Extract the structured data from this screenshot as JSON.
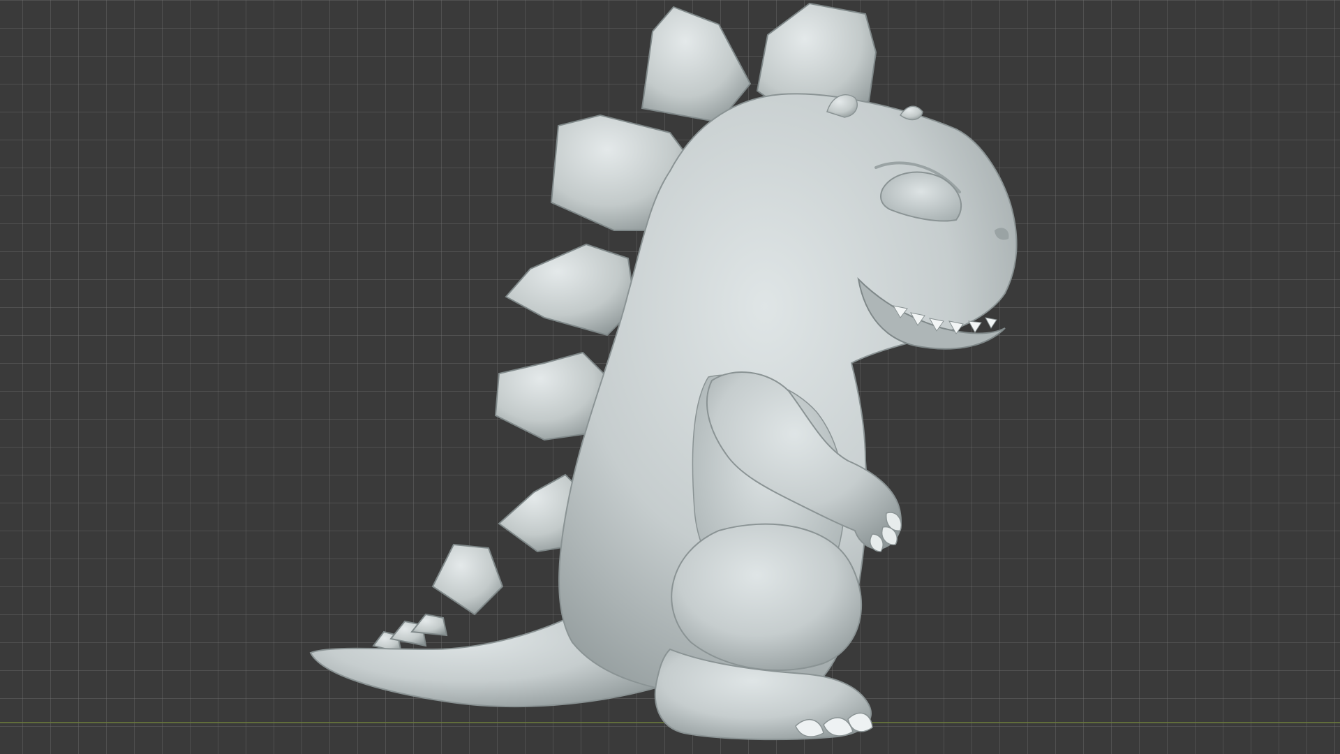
{
  "viewport": {
    "label": "",
    "background_color": "#3a3a3a",
    "grid_color": "#5a5a5a",
    "ground_axis_color": "#6b7a3c",
    "model": {
      "name": "",
      "surface_color": "#c9d0d1",
      "shadow_color": "#8e9798"
    }
  }
}
